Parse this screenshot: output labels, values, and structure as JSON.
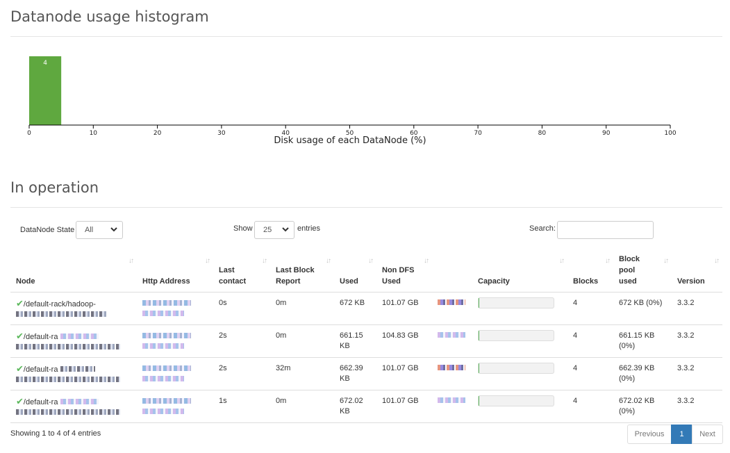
{
  "histogram": {
    "title": "Datanode usage histogram",
    "xlabel": "Disk usage of each DataNode (%)"
  },
  "chart_data": {
    "type": "bar",
    "title": "Datanode usage histogram",
    "xlabel": "Disk usage of each DataNode (%)",
    "ylabel": "",
    "xlim": [
      0,
      100
    ],
    "x_ticks": [
      "0",
      "10",
      "20",
      "30",
      "40",
      "50",
      "60",
      "70",
      "80",
      "90",
      "100"
    ],
    "bins": [
      {
        "x0": 0,
        "x1": 5,
        "value": 4,
        "label": "4"
      }
    ],
    "bar_color": "#5fa83f"
  },
  "operation": {
    "title": "In operation",
    "state_label": "DataNode State",
    "state_value": "All",
    "show_label": "Show",
    "show_value": "25",
    "entries_label": "entries",
    "search_label": "Search:"
  },
  "table": {
    "columns": [
      "Node",
      "Http Address",
      "Last contact",
      "Last Block Report",
      "Used",
      "Non DFS Used",
      "",
      "Capacity",
      "Blocks",
      "Block pool used",
      "Version"
    ],
    "rows": [
      {
        "node": "/default-rack/hadoop-",
        "last_contact": "0s",
        "last_block_report": "0m",
        "used": "672 KB",
        "non_dfs_used": "101.07 GB",
        "capacity_fraction": 0.01,
        "blocks": "4",
        "block_pool_used": "672 KB (0%)",
        "version": "3.3.2"
      },
      {
        "node": "/default-ra",
        "last_contact": "2s",
        "last_block_report": "0m",
        "used": "661.15 KB",
        "non_dfs_used": "104.83 GB",
        "capacity_fraction": 0.01,
        "blocks": "4",
        "block_pool_used": "661.15 KB (0%)",
        "version": "3.3.2"
      },
      {
        "node": "/default-ra",
        "last_contact": "2s",
        "last_block_report": "32m",
        "used": "662.39 KB",
        "non_dfs_used": "101.07 GB",
        "capacity_fraction": 0.01,
        "blocks": "4",
        "block_pool_used": "662.39 KB (0%)",
        "version": "3.3.2"
      },
      {
        "node": "/default-ra",
        "last_contact": "1s",
        "last_block_report": "0m",
        "used": "672.02 KB",
        "non_dfs_used": "101.07 GB",
        "capacity_fraction": 0.01,
        "blocks": "4",
        "block_pool_used": "672.02 KB (0%)",
        "version": "3.3.2"
      }
    ]
  },
  "footer": {
    "info": "Showing 1 to 4 of 4 entries",
    "previous": "Previous",
    "page": "1",
    "next": "Next"
  },
  "colors": {
    "accent": "#337ab7",
    "bar": "#5fa83f",
    "status_ok": "#5cb85c"
  },
  "icons": {
    "status": "check-icon",
    "sort": "sort-arrows-icon",
    "dropdown": "chevron-down-icon"
  }
}
